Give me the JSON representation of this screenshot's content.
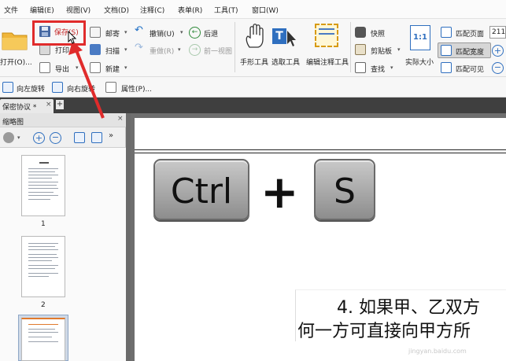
{
  "menu": [
    "文件",
    "编辑(E)",
    "视图(V)",
    "文档(D)",
    "注释(C)",
    "表单(R)",
    "工具(T)",
    "窗口(W)"
  ],
  "ribbon": {
    "open_label": "打开(O)...",
    "save_label": "保存(S)",
    "print_label": "打印...",
    "export_label": "导出",
    "mail_label": "邮寄",
    "scan_label": "扫描",
    "new_label": "新建",
    "undo_label": "撤销(U)",
    "redo_label": "重做(R)",
    "back_label": "后退",
    "prev_view_label": "前一视图",
    "hand_tool_label": "手形工具",
    "select_tool_label": "选取工具",
    "edit_annot_label": "编辑注释工具",
    "snapshot_label": "快照",
    "clipboard_label": "剪贴板",
    "find_label": "查找",
    "actual_size_label": "实际大小",
    "actual_size_glyph": "1:1",
    "fit_page_label": "匹配页面",
    "fit_width_label": "匹配宽度",
    "fit_visible_label": "匹配可见",
    "zoom_value": "211"
  },
  "toolbar2": {
    "rotate_left": "向左旋转",
    "rotate_right": "向右旋转",
    "properties": "属性(P)..."
  },
  "tab": {
    "doc_title": "保密协议 *",
    "close": "×",
    "new": "+"
  },
  "sidebar": {
    "title": "缩略图",
    "close": "×",
    "pages": [
      "1",
      "2"
    ]
  },
  "document": {
    "key1": "Ctrl",
    "plus": "+",
    "key2": "S",
    "line1": "4. 如果甲、乙双方",
    "line2": "何一方可直接向甲方所"
  },
  "colors": {
    "highlight": "#e02b2b",
    "accent_blue": "#1f6fc5",
    "tab_bar": "#3f3f3f"
  },
  "watermark": "jingyan.baidu.com"
}
